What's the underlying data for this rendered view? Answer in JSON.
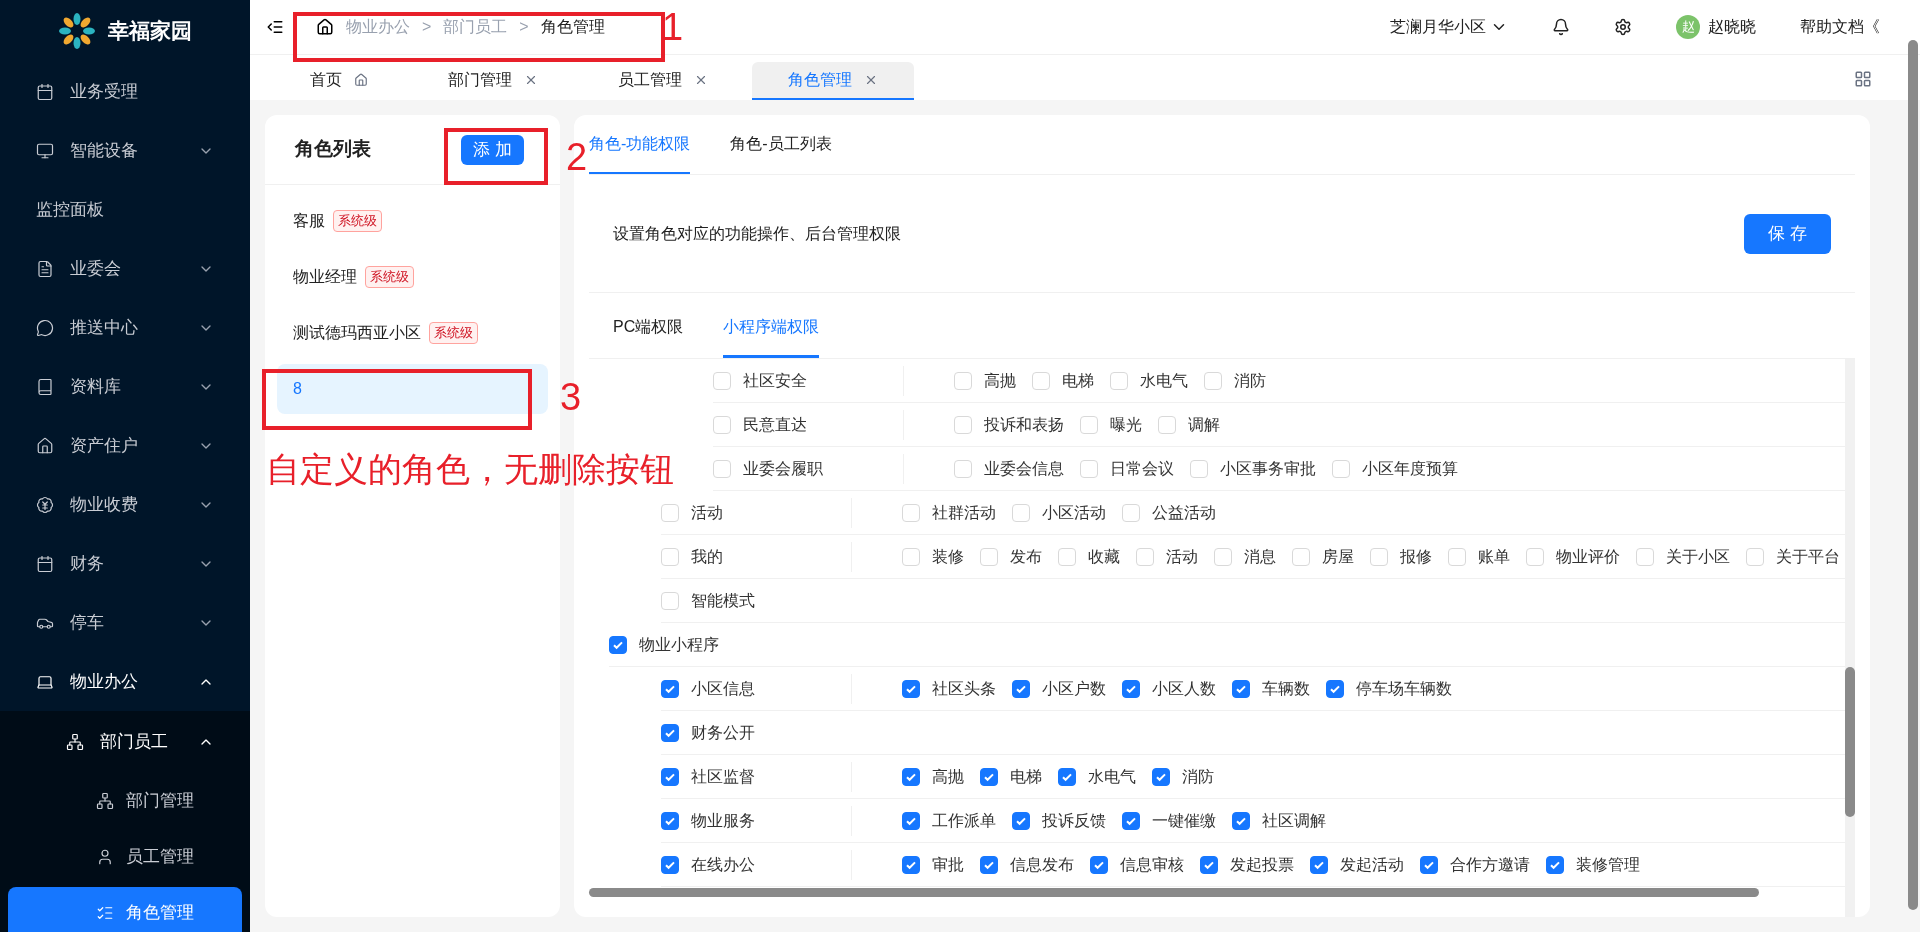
{
  "brand": {
    "name": "幸福家园"
  },
  "sidebar": {
    "items": [
      {
        "label": "业务受理"
      },
      {
        "label": "智能设备",
        "expanded": false
      },
      {
        "label": "监控面板"
      },
      {
        "label": "业委会",
        "expanded": false
      },
      {
        "label": "推送中心",
        "expanded": false
      },
      {
        "label": "资料库",
        "expanded": false
      },
      {
        "label": "资产住户",
        "expanded": false
      },
      {
        "label": "物业收费",
        "expanded": false
      },
      {
        "label": "财务",
        "expanded": false
      },
      {
        "label": "停车",
        "expanded": false
      },
      {
        "label": "物业办公",
        "expanded": true,
        "children": [
          {
            "label": "部门员工",
            "expanded": true,
            "children": [
              {
                "label": "部门管理",
                "selected": false
              },
              {
                "label": "员工管理",
                "selected": false
              },
              {
                "label": "角色管理",
                "selected": true
              }
            ]
          }
        ]
      }
    ]
  },
  "header": {
    "breadcrumb": [
      "物业办公",
      "部门员工",
      "角色管理"
    ],
    "separator": ">",
    "community": "芝澜月华小区",
    "avatar": "赵",
    "user": "赵晓晓",
    "help": "帮助文档《"
  },
  "tabs": [
    {
      "label": "首页",
      "closable": false,
      "selected": false
    },
    {
      "label": "部门管理",
      "closable": true,
      "selected": false
    },
    {
      "label": "员工管理",
      "closable": true,
      "selected": false
    },
    {
      "label": "角色管理",
      "closable": true,
      "selected": true
    }
  ],
  "role_list": {
    "title": "角色列表",
    "add_button": "添 加",
    "roles": [
      {
        "name": "客服",
        "tag": "系统级",
        "selected": false
      },
      {
        "name": "物业经理",
        "tag": "系统级",
        "selected": false
      },
      {
        "name": "测试德玛西亚小区",
        "tag": "系统级",
        "selected": false
      },
      {
        "name": "8",
        "selected": true
      }
    ]
  },
  "panel": {
    "tabs": [
      {
        "label": "角色-功能权限",
        "selected": true
      },
      {
        "label": "角色-员工列表",
        "selected": false
      }
    ],
    "description": "设置角色对应的功能操作、后台管理权限",
    "save_button": "保 存",
    "sub_tabs": [
      {
        "label": "PC端权限",
        "selected": false
      },
      {
        "label": "小程序端权限",
        "selected": true
      }
    ],
    "tree": [
      {
        "children": [
          {
            "children": [
              {
                "label": "社区安全",
                "checked": false,
                "options": [
                  {
                    "label": "高抛",
                    "checked": false
                  },
                  {
                    "label": "电梯",
                    "checked": false
                  },
                  {
                    "label": "水电气",
                    "checked": false
                  },
                  {
                    "label": "消防",
                    "checked": false
                  }
                ]
              },
              {
                "label": "民意直达",
                "checked": false,
                "options": [
                  {
                    "label": "投诉和表扬",
                    "checked": false
                  },
                  {
                    "label": "曝光",
                    "checked": false
                  },
                  {
                    "label": "调解",
                    "checked": false
                  }
                ]
              },
              {
                "label": "业委会履职",
                "checked": false,
                "options": [
                  {
                    "label": "业委会信息",
                    "checked": false
                  },
                  {
                    "label": "日常会议",
                    "checked": false
                  },
                  {
                    "label": "小区事务审批",
                    "checked": false
                  },
                  {
                    "label": "小区年度预算",
                    "checked": false
                  }
                ]
              }
            ]
          },
          {
            "label": "活动",
            "checked": false,
            "options": [
              {
                "label": "社群活动",
                "checked": false
              },
              {
                "label": "小区活动",
                "checked": false
              },
              {
                "label": "公益活动",
                "checked": false
              }
            ]
          },
          {
            "label": "我的",
            "checked": false,
            "options": [
              {
                "label": "装修",
                "checked": false
              },
              {
                "label": "发布",
                "checked": false
              },
              {
                "label": "收藏",
                "checked": false
              },
              {
                "label": "活动",
                "checked": false
              },
              {
                "label": "消息",
                "checked": false
              },
              {
                "label": "房屋",
                "checked": false
              },
              {
                "label": "报修",
                "checked": false
              },
              {
                "label": "账单",
                "checked": false
              },
              {
                "label": "物业评价",
                "checked": false
              },
              {
                "label": "关于小区",
                "checked": false
              },
              {
                "label": "关于平台",
                "checked": false
              }
            ]
          },
          {
            "label": "智能模式",
            "checked": false
          }
        ]
      },
      {
        "label": "物业小程序",
        "checked": true,
        "children": [
          {
            "label": "小区信息",
            "checked": true,
            "options": [
              {
                "label": "社区头条",
                "checked": true
              },
              {
                "label": "小区户数",
                "checked": true
              },
              {
                "label": "小区人数",
                "checked": true
              },
              {
                "label": "车辆数",
                "checked": true
              },
              {
                "label": "停车场车辆数",
                "checked": true
              }
            ]
          },
          {
            "label": "财务公开",
            "checked": true
          },
          {
            "label": "社区监督",
            "checked": true,
            "options": [
              {
                "label": "高抛",
                "checked": true
              },
              {
                "label": "电梯",
                "checked": true
              },
              {
                "label": "水电气",
                "checked": true
              },
              {
                "label": "消防",
                "checked": true
              }
            ]
          },
          {
            "label": "物业服务",
            "checked": true,
            "options": [
              {
                "label": "工作派单",
                "checked": true
              },
              {
                "label": "投诉反馈",
                "checked": true
              },
              {
                "label": "一键催缴",
                "checked": true
              },
              {
                "label": "社区调解",
                "checked": true
              }
            ]
          },
          {
            "label": "在线办公",
            "checked": true,
            "options": [
              {
                "label": "审批",
                "checked": true
              },
              {
                "label": "信息发布",
                "checked": true
              },
              {
                "label": "信息审核",
                "checked": true
              },
              {
                "label": "发起投票",
                "checked": true
              },
              {
                "label": "发起活动",
                "checked": true
              },
              {
                "label": "合作方邀请",
                "checked": true
              },
              {
                "label": "装修管理",
                "checked": true
              }
            ]
          }
        ]
      }
    ]
  },
  "annotations": [
    {
      "kind": "number",
      "text": "1"
    },
    {
      "kind": "number",
      "text": "2"
    },
    {
      "kind": "number",
      "text": "3"
    },
    {
      "kind": "note",
      "text": "自定义的角色，无删除按钮"
    }
  ]
}
